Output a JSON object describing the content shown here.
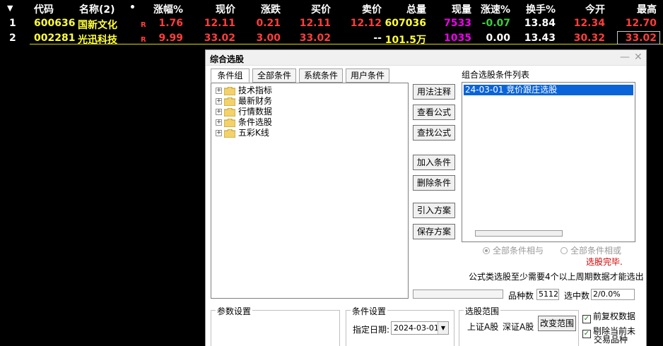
{
  "table": {
    "sort_arrow": "▼",
    "headers": [
      "代码",
      "名称(2)",
      "•",
      "涨幅%",
      "现价",
      "涨跌",
      "买价",
      "卖价",
      "总量",
      "现量",
      "涨速%",
      "换手%",
      "今开",
      "最高"
    ],
    "rows": [
      {
        "idx": "1",
        "code": "600636",
        "name": "国新文化",
        "flag": "R",
        "chg_pct": "1.76",
        "price": "12.11",
        "chg": "0.21",
        "bid": "12.11",
        "ask": "12.12",
        "volume": "607036",
        "cur_vol": "7533",
        "speed": "-0.07",
        "turnover": "13.84",
        "open": "12.34",
        "high": "12.70"
      },
      {
        "idx": "2",
        "code": "002281",
        "name": "光迅科技",
        "flag": "R",
        "chg_pct": "9.99",
        "price": "33.02",
        "chg": "3.00",
        "bid": "33.02",
        "ask": "--",
        "volume": "101.5万",
        "cur_vol": "1035",
        "speed": "0.00",
        "turnover": "13.43",
        "open": "30.32",
        "high": "33.02"
      }
    ]
  },
  "dialog": {
    "title": "综合选股",
    "window_controls": [
      "—",
      "✕"
    ],
    "tabs": [
      "条件组",
      "全部条件",
      "系统条件",
      "用户条件"
    ],
    "tree": [
      "技术指标",
      "最新财务",
      "行情数据",
      "条件选股",
      "五彩K线"
    ],
    "buttons": {
      "usage": "用法注释",
      "view_formula": "查看公式",
      "find_formula": "查找公式",
      "add_cond": "加入条件",
      "del_cond": "删除条件",
      "import_plan": "引入方案",
      "save_plan": "保存方案",
      "change_range": "改变范围"
    },
    "list_label": "组合选股条件列表",
    "list_items": [
      "24-03-01 竞价跟庄选股"
    ],
    "radio_and": "全部条件相与",
    "radio_or": "全部条件相或",
    "status_done": "选股完毕.",
    "note": "公式类选股至少需要4个以上周期数据才能选出",
    "count_label": "品种数",
    "count_value": "5112",
    "selected_label": "选中数",
    "selected_value": "2/0.0%",
    "param_group": "参数设置",
    "cond_group": "条件设置",
    "date_label": "指定日期:",
    "date_value": "2024-03-01",
    "range_group": "选股范围",
    "range_sh": "上证A股",
    "range_sz": "深证A股",
    "chk_restore": "前复权数据",
    "chk_exclude_1": "剔除当前未",
    "chk_exclude_2": "交易品种"
  },
  "colors": {
    "accent_yellow": "#ffff3c",
    "up_red": "#ff3d3d",
    "down_green": "#3ecc3e",
    "selection_blue": "#0a64d8"
  }
}
